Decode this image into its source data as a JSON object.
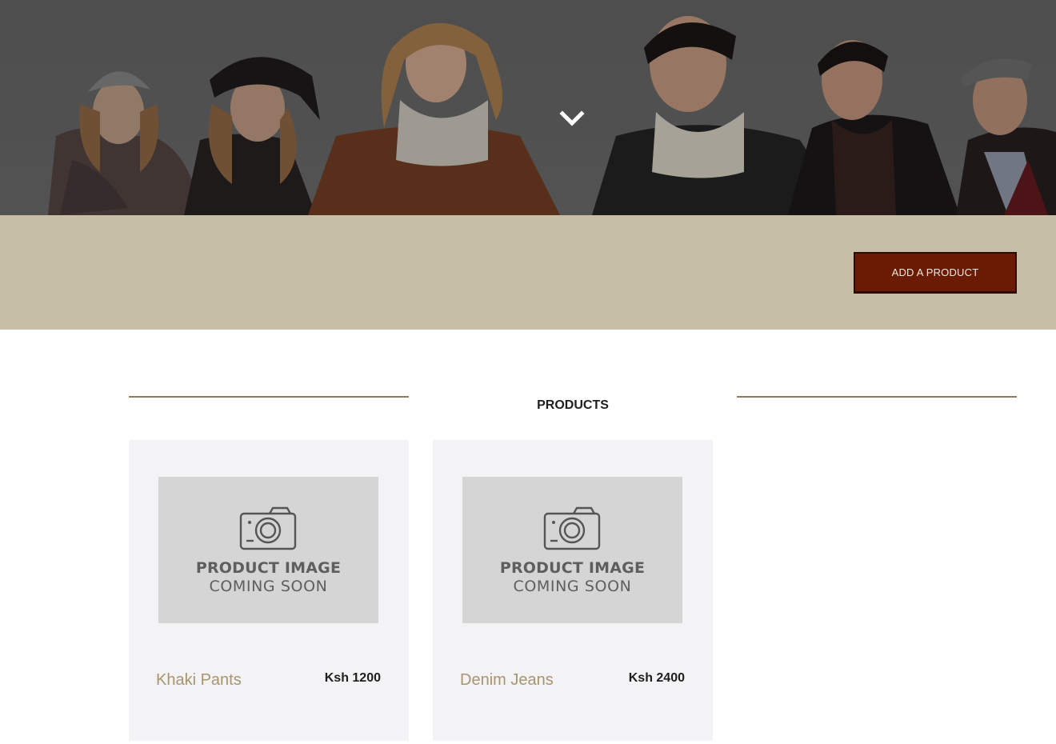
{
  "hero": {
    "scroll_icon": "chevron-down-icon"
  },
  "toolbar": {
    "add_product_label": "ADD A PRODUCT"
  },
  "products_section": {
    "title": "PRODUCTS",
    "placeholder_line1": "PRODUCT IMAGE",
    "placeholder_line2": "COMING SOON",
    "items": [
      {
        "name": "Khaki Pants",
        "price": "Ksh 1200"
      },
      {
        "name": "Denim Jeans",
        "price": "Ksh 2400"
      }
    ]
  },
  "colors": {
    "band": "#c6bea5",
    "button": "#6b1a04",
    "rule": "#8d7b5f",
    "product_name": "#a8946f",
    "card_bg": "#f3f3f5",
    "placeholder_bg": "#d5d5d5"
  }
}
